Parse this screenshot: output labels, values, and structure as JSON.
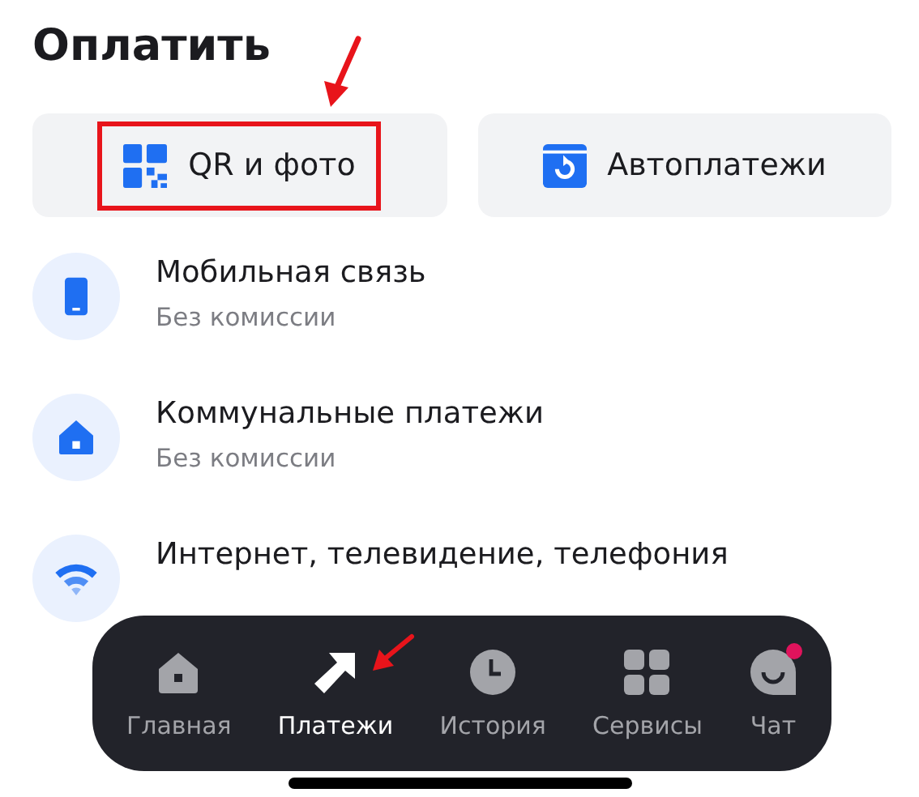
{
  "header": {
    "title": "Оплатить"
  },
  "quick_actions": [
    {
      "kind": "qr",
      "label": "QR и фото",
      "highlighted": true
    },
    {
      "kind": "autopay",
      "label": "Автоплатежи",
      "highlighted": false
    }
  ],
  "payments": [
    {
      "kind": "mobile",
      "title": "Мобильная связь",
      "subtitle": "Без комиссии"
    },
    {
      "kind": "home",
      "title": "Коммунальные платежи",
      "subtitle": "Без комиссии"
    },
    {
      "kind": "wifi",
      "title": "Интернет, телевидение, телефония"
    }
  ],
  "tab_bar": [
    {
      "kind": "home",
      "label": "Главная",
      "selected": false
    },
    {
      "kind": "payments",
      "label": "Платежи",
      "selected": true
    },
    {
      "kind": "history",
      "label": "История",
      "selected": false
    },
    {
      "kind": "services",
      "label": "Сервисы",
      "selected": false
    },
    {
      "kind": "chat",
      "label": "Чат",
      "selected": false,
      "badge": true
    }
  ]
}
